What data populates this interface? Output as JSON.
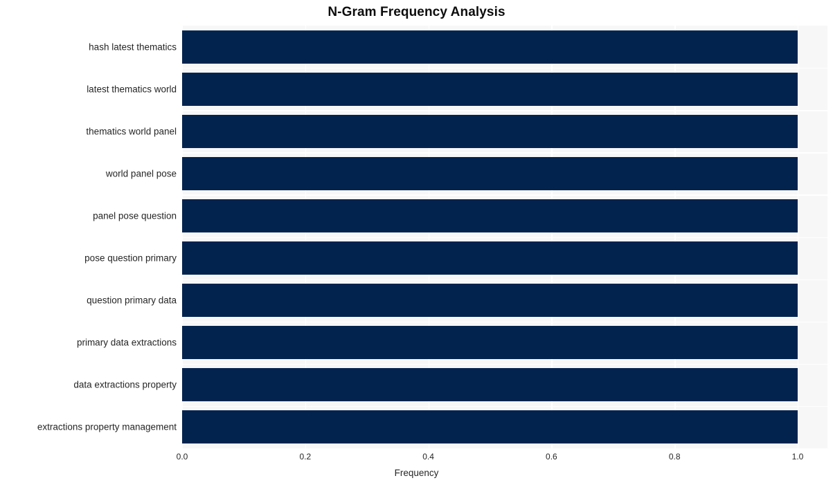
{
  "chart_data": {
    "type": "bar",
    "orientation": "horizontal",
    "title": "N-Gram Frequency Analysis",
    "xlabel": "Frequency",
    "ylabel": "",
    "xlim": [
      0.0,
      1.0
    ],
    "xticks": [
      "0.0",
      "0.2",
      "0.4",
      "0.6",
      "0.8",
      "1.0"
    ],
    "xtick_values": [
      0.0,
      0.2,
      0.4,
      0.6,
      0.8,
      1.0
    ],
    "grid": true,
    "legend": false,
    "categories": [
      "hash latest thematics",
      "latest thematics world",
      "thematics world panel",
      "world panel pose",
      "panel pose question",
      "pose question primary",
      "question primary data",
      "primary data extractions",
      "data extractions property",
      "extractions property management"
    ],
    "values": [
      1.0,
      1.0,
      1.0,
      1.0,
      1.0,
      1.0,
      1.0,
      1.0,
      1.0,
      1.0
    ],
    "colors": {
      "bar": "#03234f",
      "plot_background": "#f7f7f7",
      "figure_background": "#ffffff",
      "grid": "#ffffff",
      "text": "#262626",
      "title": "#0d0d0d"
    }
  }
}
